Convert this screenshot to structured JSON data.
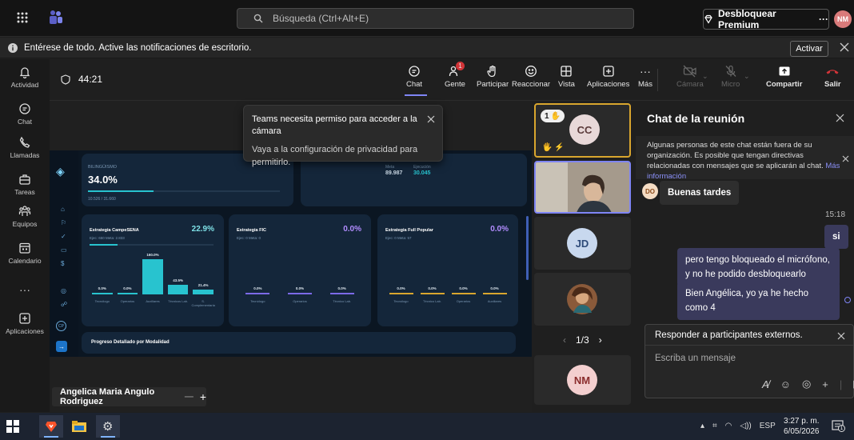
{
  "topbar": {
    "search_placeholder": "Búsqueda (Ctrl+Alt+E)",
    "premium_label": "Desbloquear Premium",
    "avatar_initials": "NM"
  },
  "notification": {
    "text": "Entérese de todo. Active las notificaciones de escritorio.",
    "button": "Activar"
  },
  "rail": [
    {
      "label": "Actividad",
      "icon": "bell-icon"
    },
    {
      "label": "Chat",
      "icon": "chat-icon"
    },
    {
      "label": "Llamadas",
      "icon": "phone-icon"
    },
    {
      "label": "Tareas",
      "icon": "briefcase-icon"
    },
    {
      "label": "Equipos",
      "icon": "teams-icon"
    },
    {
      "label": "Calendario",
      "icon": "calendar-icon"
    },
    {
      "label": "Aplicaciones",
      "icon": "add-apps-icon"
    }
  ],
  "meeting": {
    "timer": "44:21",
    "toolbar": {
      "chat": "Chat",
      "people": "Gente",
      "people_badge": "1",
      "raise": "Participar",
      "react": "Reaccionar",
      "view": "Vista",
      "apps": "Aplicaciones",
      "more": "Más",
      "camera": "Cámara",
      "mic": "Micro",
      "share": "Compartir",
      "leave": "Salir"
    }
  },
  "toast": {
    "title": "Teams necesita permiso para acceder a la cámara",
    "body": "Vaya a la configuración de privacidad para permitirlo."
  },
  "dashboard": {
    "top_label": "BILINGÜISMO",
    "top_value": "34.0%",
    "top_sub": "10.526 / 31.660",
    "meta_label": "Meta",
    "meta_value": "89.987",
    "exec_label": "Ejecución",
    "exec_value": "30.045",
    "cards": [
      {
        "title": "Estrategia CampeSENA",
        "pct": "22.9%",
        "sub": "Ejec: 650   Meta: 2.833",
        "bars": [
          {
            "label": "Tecnólogo",
            "value": "0.0%",
            "pct": 0
          },
          {
            "label": "Operarios",
            "value": "0.0%",
            "pct": 0
          },
          {
            "label": "Auxiliares",
            "value": "160.0%",
            "pct": 160
          },
          {
            "label": "Técnicos Lab.",
            "value": "43.5%",
            "pct": 43.5
          },
          {
            "label": "S. Complementaria",
            "value": "21.4%",
            "pct": 21.4
          }
        ]
      },
      {
        "title": "Estrategia FIC",
        "pct": "0.0%",
        "sub": "Ejec: 0   Meta: 0",
        "bars": [
          {
            "label": "Tecnólogo",
            "value": "0.0%",
            "pct": 0
          },
          {
            "label": "Operarios",
            "value": "0.0%",
            "pct": 0
          },
          {
            "label": "Técnico Lab.",
            "value": "0.0%",
            "pct": 0
          }
        ]
      },
      {
        "title": "Estrategia Full Popular",
        "pct": "0.0%",
        "sub": "Ejec: 0   Meta: 57",
        "bars": [
          {
            "label": "Tecnólogo",
            "value": "0.0%",
            "pct": 0
          },
          {
            "label": "Técnico Lab.",
            "value": "0.0%",
            "pct": 0
          },
          {
            "label": "Operarios",
            "value": "0.0%",
            "pct": 0
          },
          {
            "label": "Auxiliares",
            "value": "0.0%",
            "pct": 0
          }
        ]
      }
    ],
    "progress_title": "Progreso Detallado por Modalidad"
  },
  "presenter_name": "Angelica Maria Angulo Rodriguez",
  "gallery": {
    "tiles": [
      {
        "initials": "CC",
        "raised": "1"
      },
      {
        "initials": ""
      },
      {
        "initials": "JD"
      },
      {
        "initials": ""
      },
      {
        "initials": "NM"
      }
    ],
    "pager": "1/3"
  },
  "chat": {
    "title": "Chat de la reunión",
    "banner": "Algunas personas de este chat están fuera de su organización. Es posible que tengan directivas relacionadas con mensajes que se aplicarán al chat.",
    "banner_link": "Más información",
    "messages": [
      {
        "from": "DO",
        "text": "Buenas tardes"
      },
      {
        "time": "15:18",
        "text": "si"
      },
      {
        "text": "pero tengo bloqueado el micrófono, y no he podido desbloquearlo"
      },
      {
        "text": "Bien Angélica, yo ya he hecho como 4"
      }
    ],
    "reply_label": "Responder a participantes externos.",
    "input_placeholder": "Escriba un mensaje"
  },
  "taskbar": {
    "lang": "ESP",
    "time": "3:27 p. m.",
    "date": "6/05/2026",
    "notif_count": "1"
  }
}
